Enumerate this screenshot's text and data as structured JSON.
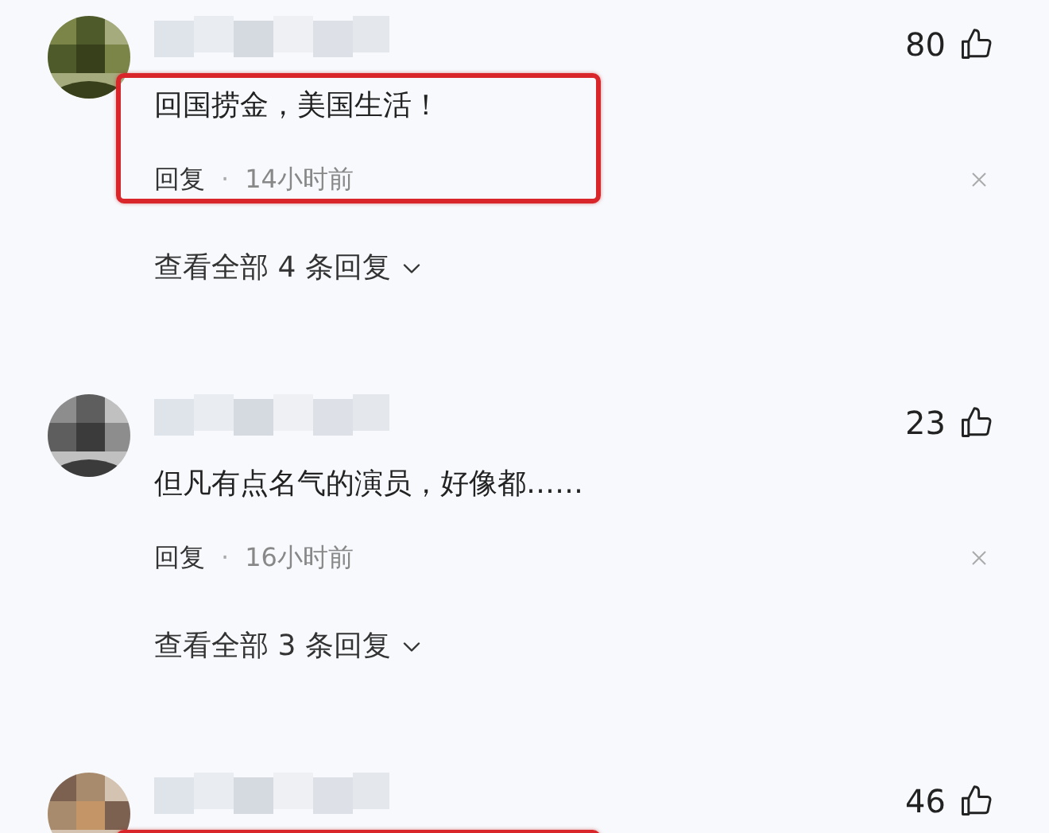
{
  "comments": [
    {
      "likes": "80",
      "highlighted": true,
      "text": "回国捞金，美国生活！",
      "reply": "回复",
      "separator": "·",
      "time": "14小时前",
      "view_replies": "查看全部 4 条回复"
    },
    {
      "likes": "23",
      "highlighted": false,
      "text": "但凡有点名气的演员，好像都……",
      "reply": "回复",
      "separator": "·",
      "time": "16小时前",
      "view_replies": "查看全部 3 条回复"
    },
    {
      "likes": "46",
      "highlighted": true
    }
  ]
}
